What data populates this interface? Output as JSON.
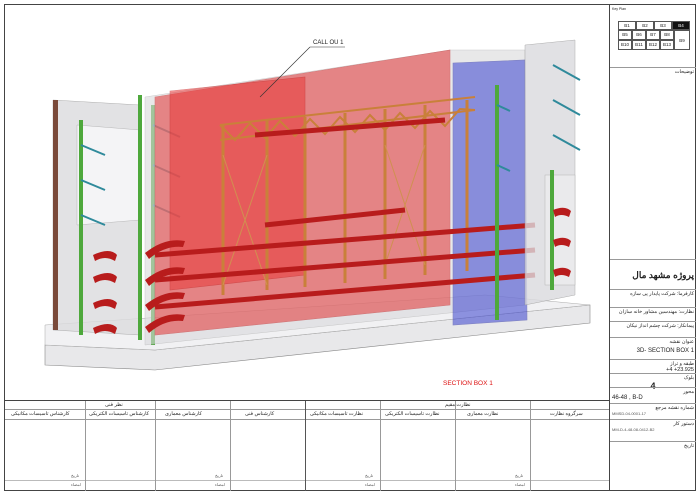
{
  "drawing": {
    "callout_label": "CALL OU 1",
    "section_label": "SECTION BOX 1"
  },
  "keyplan": {
    "title": "Key Plan",
    "cells": [
      "B1",
      "B2",
      "B3",
      "B4",
      "B5",
      "B6",
      "B7",
      "B8",
      "B9",
      "B10",
      "B11",
      "B12",
      "B13"
    ],
    "active": "B4"
  },
  "titleblock": {
    "notes_label": "توضیحات",
    "project_title": "پروژه مشهد مال",
    "employer": "کارفرما: شرکت پایدار پی سازه",
    "supervisor": "نظارت: مهندسین مشاور خانه سازان",
    "contractor": "پیمانکار: شرکت چشم انداز نیکان",
    "sheet_title_label": "عنوان نقشه",
    "sheet_title": "3D- SECTION BOX 1",
    "level_label": "طبقه و تراز",
    "level_value": "+23.925",
    "level_code": "+4",
    "block_label": "بلوک",
    "block_value": "4",
    "axis_label": "محور",
    "axis_value": "46-48 , B-D",
    "ref_label": "شماره نقشه مرجع",
    "ref_value": "MMSD-04-0001-17",
    "order_label": "دستور کار",
    "order_value": "MM-D-4-48-08-0412-B2",
    "date_label": "تاریخ"
  },
  "bottom": {
    "left_header": "نظر فنی",
    "right_header": "نظارت مقیم",
    "left_cols": [
      "کارشناس تاسیسات مکانیکی",
      "کارشناس تاسیسات الکتریکی",
      "کارشناس معماری",
      "کارشناس فنی"
    ],
    "right_cols": [
      "نظارت تاسیسات مکانیکی",
      "نظارت تاسیسات الکتریکی",
      "نظارت معماری",
      "سرگروه نظارت"
    ],
    "date_label": "تاریخ",
    "sign_label": "امضاء"
  }
}
